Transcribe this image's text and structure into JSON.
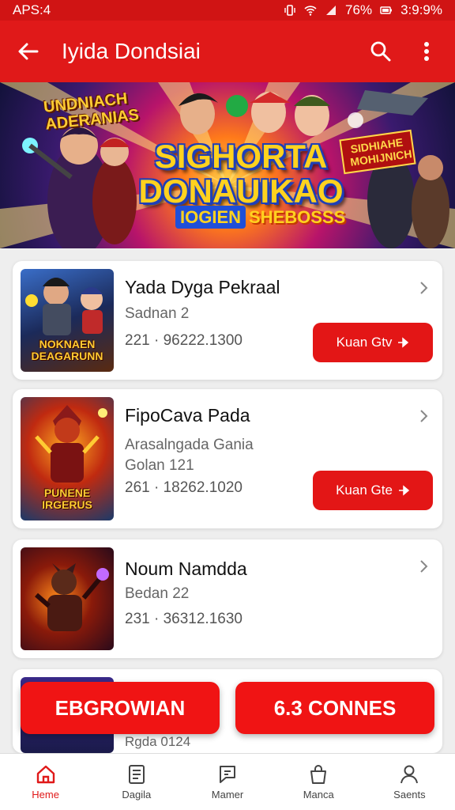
{
  "status_bar": {
    "time": "APS:4",
    "battery": "76%",
    "clock_right": "3:9:9%"
  },
  "app_bar": {
    "title": "Iyida Dondsiai"
  },
  "banner": {
    "corner_text": "UNDNIACH ADERANIAS",
    "title": "SIGHORTA DONAUIKAO",
    "sub_left": "IOGIEN",
    "sub_right": "SHEBOSSS",
    "tag": "SIDHIAHE MOHIJNICH"
  },
  "items": [
    {
      "title": "Yada Dyga Pekraal",
      "subtitle": "Sadnan 2",
      "meta": "221 · 96222.1300",
      "thumb_label": "NOKNAEN DEAGARUNN",
      "button": "Kuan Gtv"
    },
    {
      "title": "FipoCava Pada",
      "subtitle": "Arasalngada Gania",
      "subtitle2": "Golan 121",
      "meta": "261 · 18262.1020",
      "thumb_label": "PUNENE IRGERUS",
      "button": "Kuan Gte"
    },
    {
      "title": "Noum Namdda",
      "subtitle": "Bedan 22",
      "meta": "231 · 36312.1630"
    },
    {
      "subtitle": "Rgda 0124"
    }
  ],
  "floating_buttons": {
    "left": "EBGROWIAN",
    "right": "6.3 CONNES"
  },
  "bottom_nav": [
    {
      "label": "Heme",
      "icon": "home-icon",
      "active": true
    },
    {
      "label": "Dagila",
      "icon": "document-icon",
      "active": false
    },
    {
      "label": "Mamer",
      "icon": "chat-icon",
      "active": false
    },
    {
      "label": "Manca",
      "icon": "bag-icon",
      "active": false
    },
    {
      "label": "Saents",
      "icon": "person-icon",
      "active": false
    }
  ],
  "colors": {
    "primary": "#e01919",
    "status_bar": "#d01414",
    "background": "#eeeeee"
  }
}
